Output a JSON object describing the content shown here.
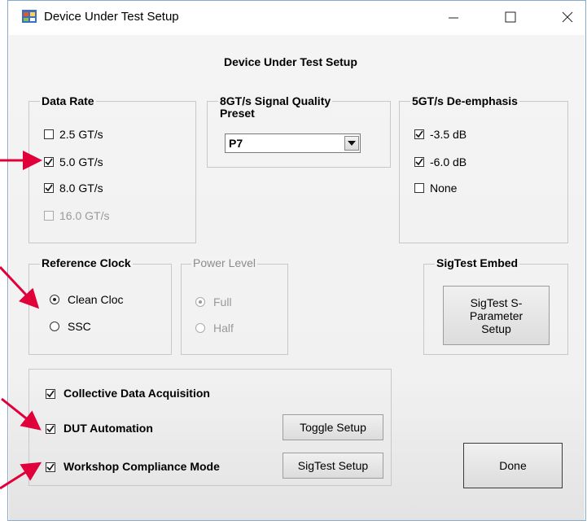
{
  "window": {
    "title": "Device Under Test Setup",
    "heading": "Device Under Test Setup"
  },
  "data_rate": {
    "legend": "Data Rate",
    "options": [
      {
        "label": "2.5 GT/s",
        "checked": false,
        "enabled": true
      },
      {
        "label": "5.0 GT/s",
        "checked": true,
        "enabled": true
      },
      {
        "label": "8.0 GT/s",
        "checked": true,
        "enabled": true
      },
      {
        "label": "16.0 GT/s",
        "checked": false,
        "enabled": false
      }
    ]
  },
  "signal_quality": {
    "legend_line1": "8GT/s Signal Quality",
    "legend_line2": "Preset",
    "selected": "P7"
  },
  "deemphasis": {
    "legend": "5GT/s De-emphasis",
    "options": [
      {
        "label": "-3.5 dB",
        "checked": true
      },
      {
        "label": "-6.0 dB",
        "checked": true
      },
      {
        "label": "None",
        "checked": false
      }
    ]
  },
  "reference_clock": {
    "legend": "Reference Clock",
    "options": [
      {
        "label": "Clean Cloc",
        "selected": true
      },
      {
        "label": "SSC",
        "selected": false
      }
    ]
  },
  "power_level": {
    "legend": "Power Level",
    "options": [
      {
        "label": "Full",
        "selected": true
      },
      {
        "label": "Half",
        "selected": false
      }
    ]
  },
  "sigtest_embed": {
    "legend": "SigTest Embed",
    "button_line1": "SigTest S-",
    "button_line2": "Parameter",
    "button_line3": "Setup"
  },
  "options": {
    "collective": {
      "label": "Collective Data Acquisition",
      "checked": true
    },
    "dut_automation": {
      "label": "DUT Automation",
      "checked": true
    },
    "workshop": {
      "label": "Workshop Compliance Mode",
      "checked": true
    },
    "toggle_setup": "Toggle Setup",
    "sigtest_setup": "SigTest Setup"
  },
  "done": "Done",
  "colors": {
    "annotation_arrow": "#e0003a",
    "app_icon": "#d84a2a"
  }
}
